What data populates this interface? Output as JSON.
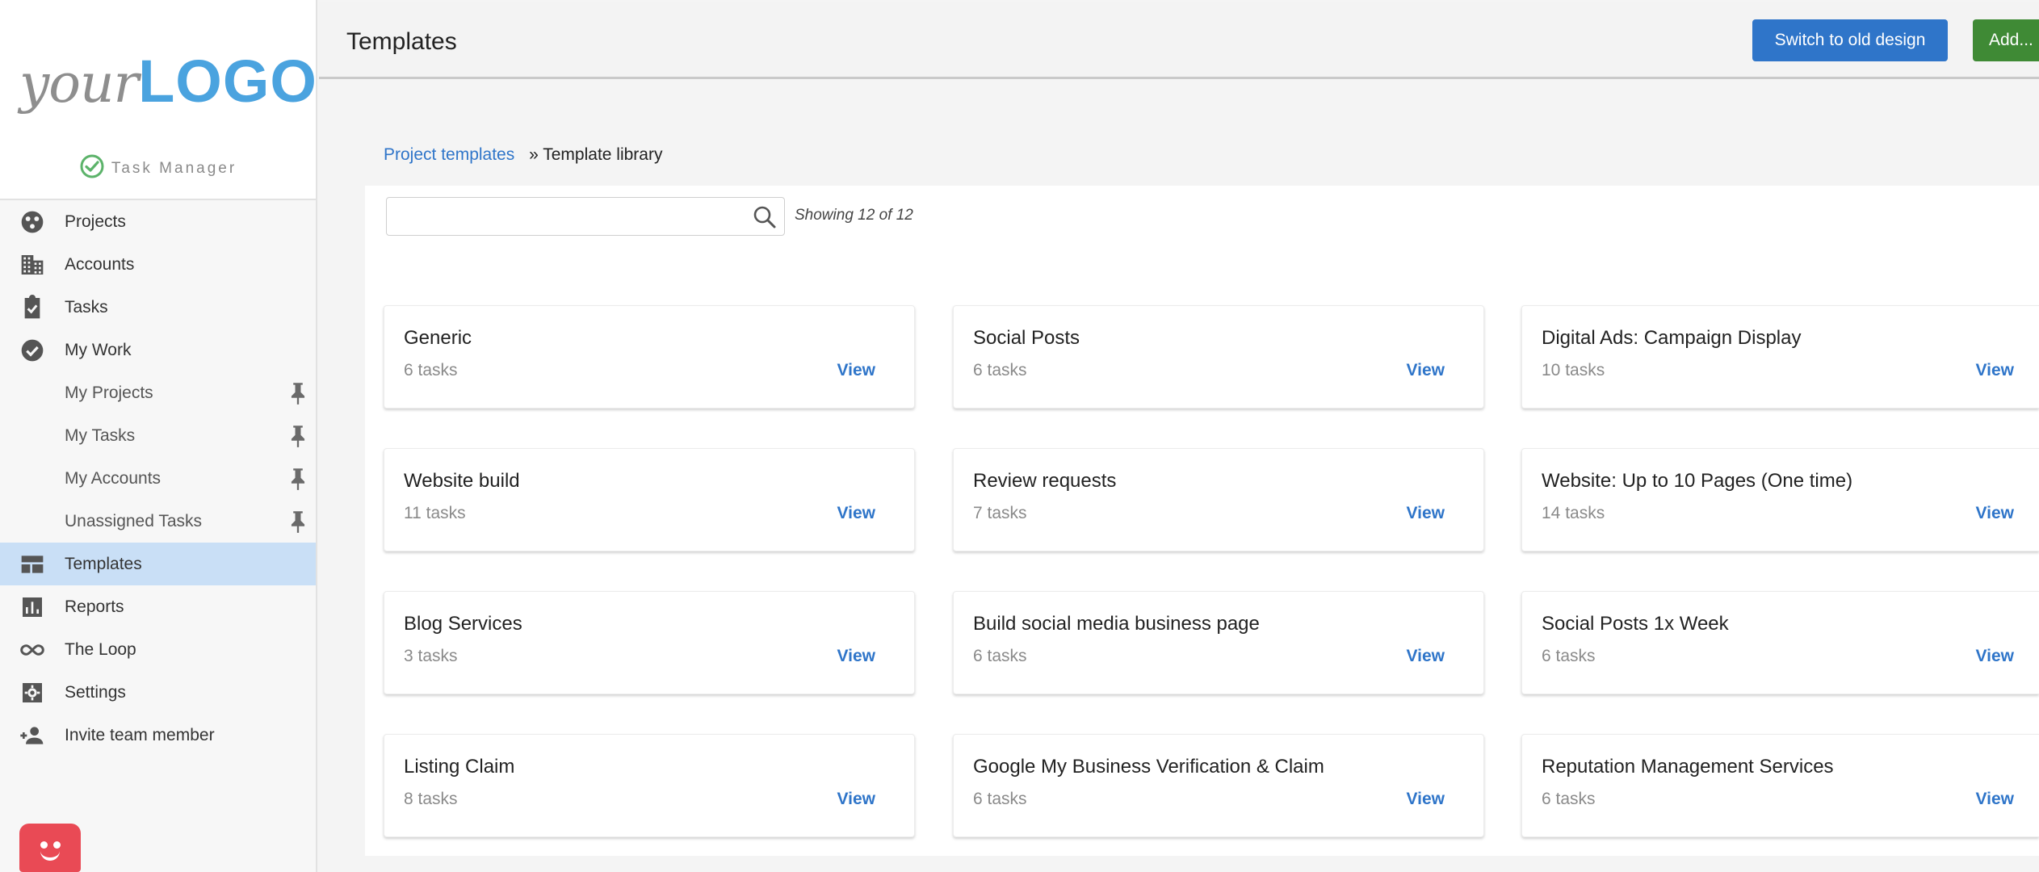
{
  "logo": {
    "part1": "your",
    "part2": "LOGO"
  },
  "app_name": "Task Manager",
  "sidebar": {
    "items": [
      {
        "label": "Projects",
        "icon": "projects-icon"
      },
      {
        "label": "Accounts",
        "icon": "building-icon"
      },
      {
        "label": "Tasks",
        "icon": "clipboard-check-icon"
      },
      {
        "label": "My Work",
        "icon": "check-circle-icon"
      },
      {
        "label": "My Projects",
        "pinned": true
      },
      {
        "label": "My Tasks",
        "pinned": true
      },
      {
        "label": "My Accounts",
        "pinned": true
      },
      {
        "label": "Unassigned Tasks",
        "pinned": true
      },
      {
        "label": "Templates",
        "icon": "templates-icon",
        "active": true
      },
      {
        "label": "Reports",
        "icon": "bar-chart-icon"
      },
      {
        "label": "The Loop",
        "icon": "infinity-icon"
      },
      {
        "label": "Settings",
        "icon": "gear-icon"
      },
      {
        "label": "Invite team member",
        "icon": "add-person-icon"
      }
    ]
  },
  "header": {
    "title": "Templates",
    "switch_button": "Switch to old design",
    "add_button": "Add..."
  },
  "breadcrumb": {
    "parent": "Project templates",
    "separator": "»",
    "current": "Template library"
  },
  "search": {
    "placeholder": "",
    "value": ""
  },
  "showing": "Showing 12 of 12",
  "view_label": "View",
  "templates": [
    {
      "name": "Generic",
      "tasks": "6 tasks"
    },
    {
      "name": "Social Posts",
      "tasks": "6 tasks"
    },
    {
      "name": "Digital Ads: Campaign Display",
      "tasks": "10 tasks"
    },
    {
      "name": "Website build",
      "tasks": "11 tasks"
    },
    {
      "name": "Review requests",
      "tasks": "7 tasks"
    },
    {
      "name": "Website: Up to 10 Pages (One time)",
      "tasks": "14 tasks"
    },
    {
      "name": "Blog Services",
      "tasks": "3 tasks"
    },
    {
      "name": "Build social media business page",
      "tasks": "6 tasks"
    },
    {
      "name": "Social Posts 1x Week",
      "tasks": "6 tasks"
    },
    {
      "name": "Listing Claim",
      "tasks": "8 tasks"
    },
    {
      "name": "Google My Business Verification & Claim",
      "tasks": "6 tasks"
    },
    {
      "name": "Reputation Management Services",
      "tasks": "6 tasks"
    }
  ],
  "colors": {
    "accent_blue": "#2f75c9",
    "add_green": "#3f8a35",
    "logo_blue": "#4aa3df",
    "active_nav": "#c9dff6",
    "chat_red": "#e94a55"
  }
}
